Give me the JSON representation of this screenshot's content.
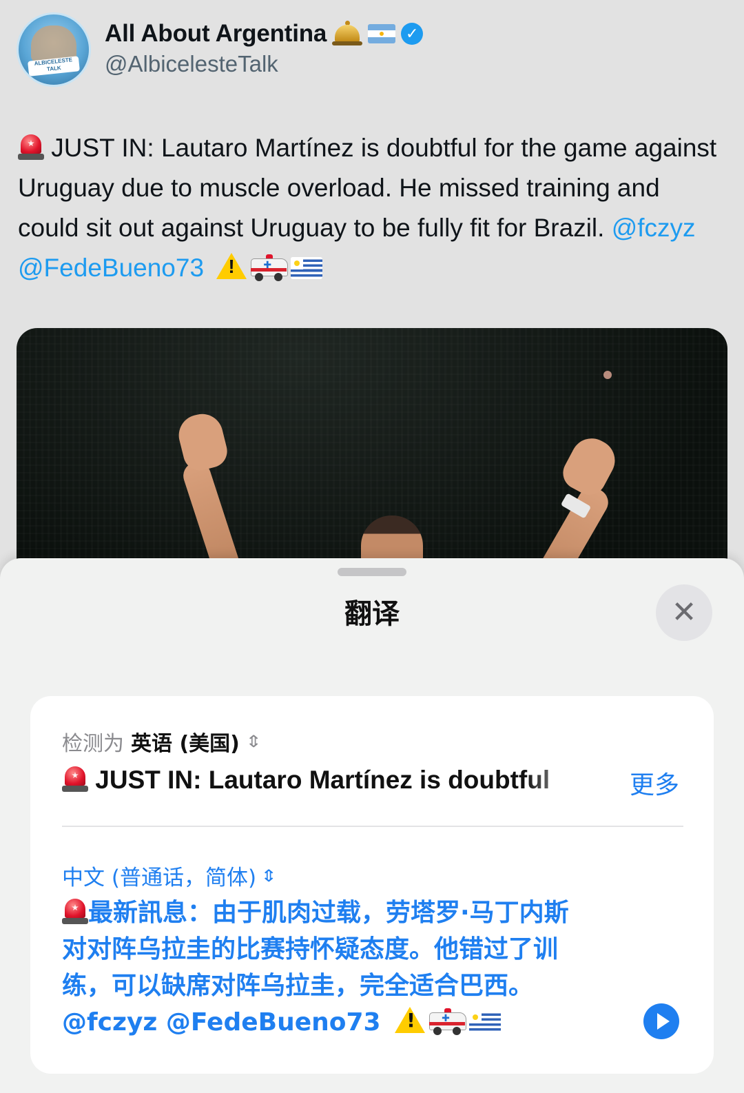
{
  "tweet": {
    "display_name": "All About Argentina",
    "handle": "@AlbicelesteTalk",
    "avatar_text": "ALBICELESTE TALK",
    "body_text": "JUST IN: Lautaro Martínez is doubtful for the game against Uruguay due to muscle overload. He missed training and could sit out against Uruguay to be fully fit for Brazil.",
    "mentions": [
      "@fczyz",
      "@FedeBueno73"
    ],
    "colors": {
      "link": "#1d9bf0",
      "verified": "#1d9bf0"
    }
  },
  "sheet": {
    "title": "翻译",
    "close_icon": "close-icon"
  },
  "translation": {
    "detected_label": "检测为",
    "source_language": "英语 (美国)",
    "source_text": "JUST IN: Lautaro Martínez is doubtful",
    "more_label": "更多",
    "target_language": "中文 (普通话，简体)",
    "target_text": "最新訊息：由于肌肉过载，劳塔罗·马丁内斯对对阵乌拉圭的比赛持怀疑态度。他错过了训练，可以缺席对阵乌拉圭，完全适合巴西。",
    "target_mentions": "@fczyz @FedeBueno73",
    "accent": "#1f7ff0"
  }
}
